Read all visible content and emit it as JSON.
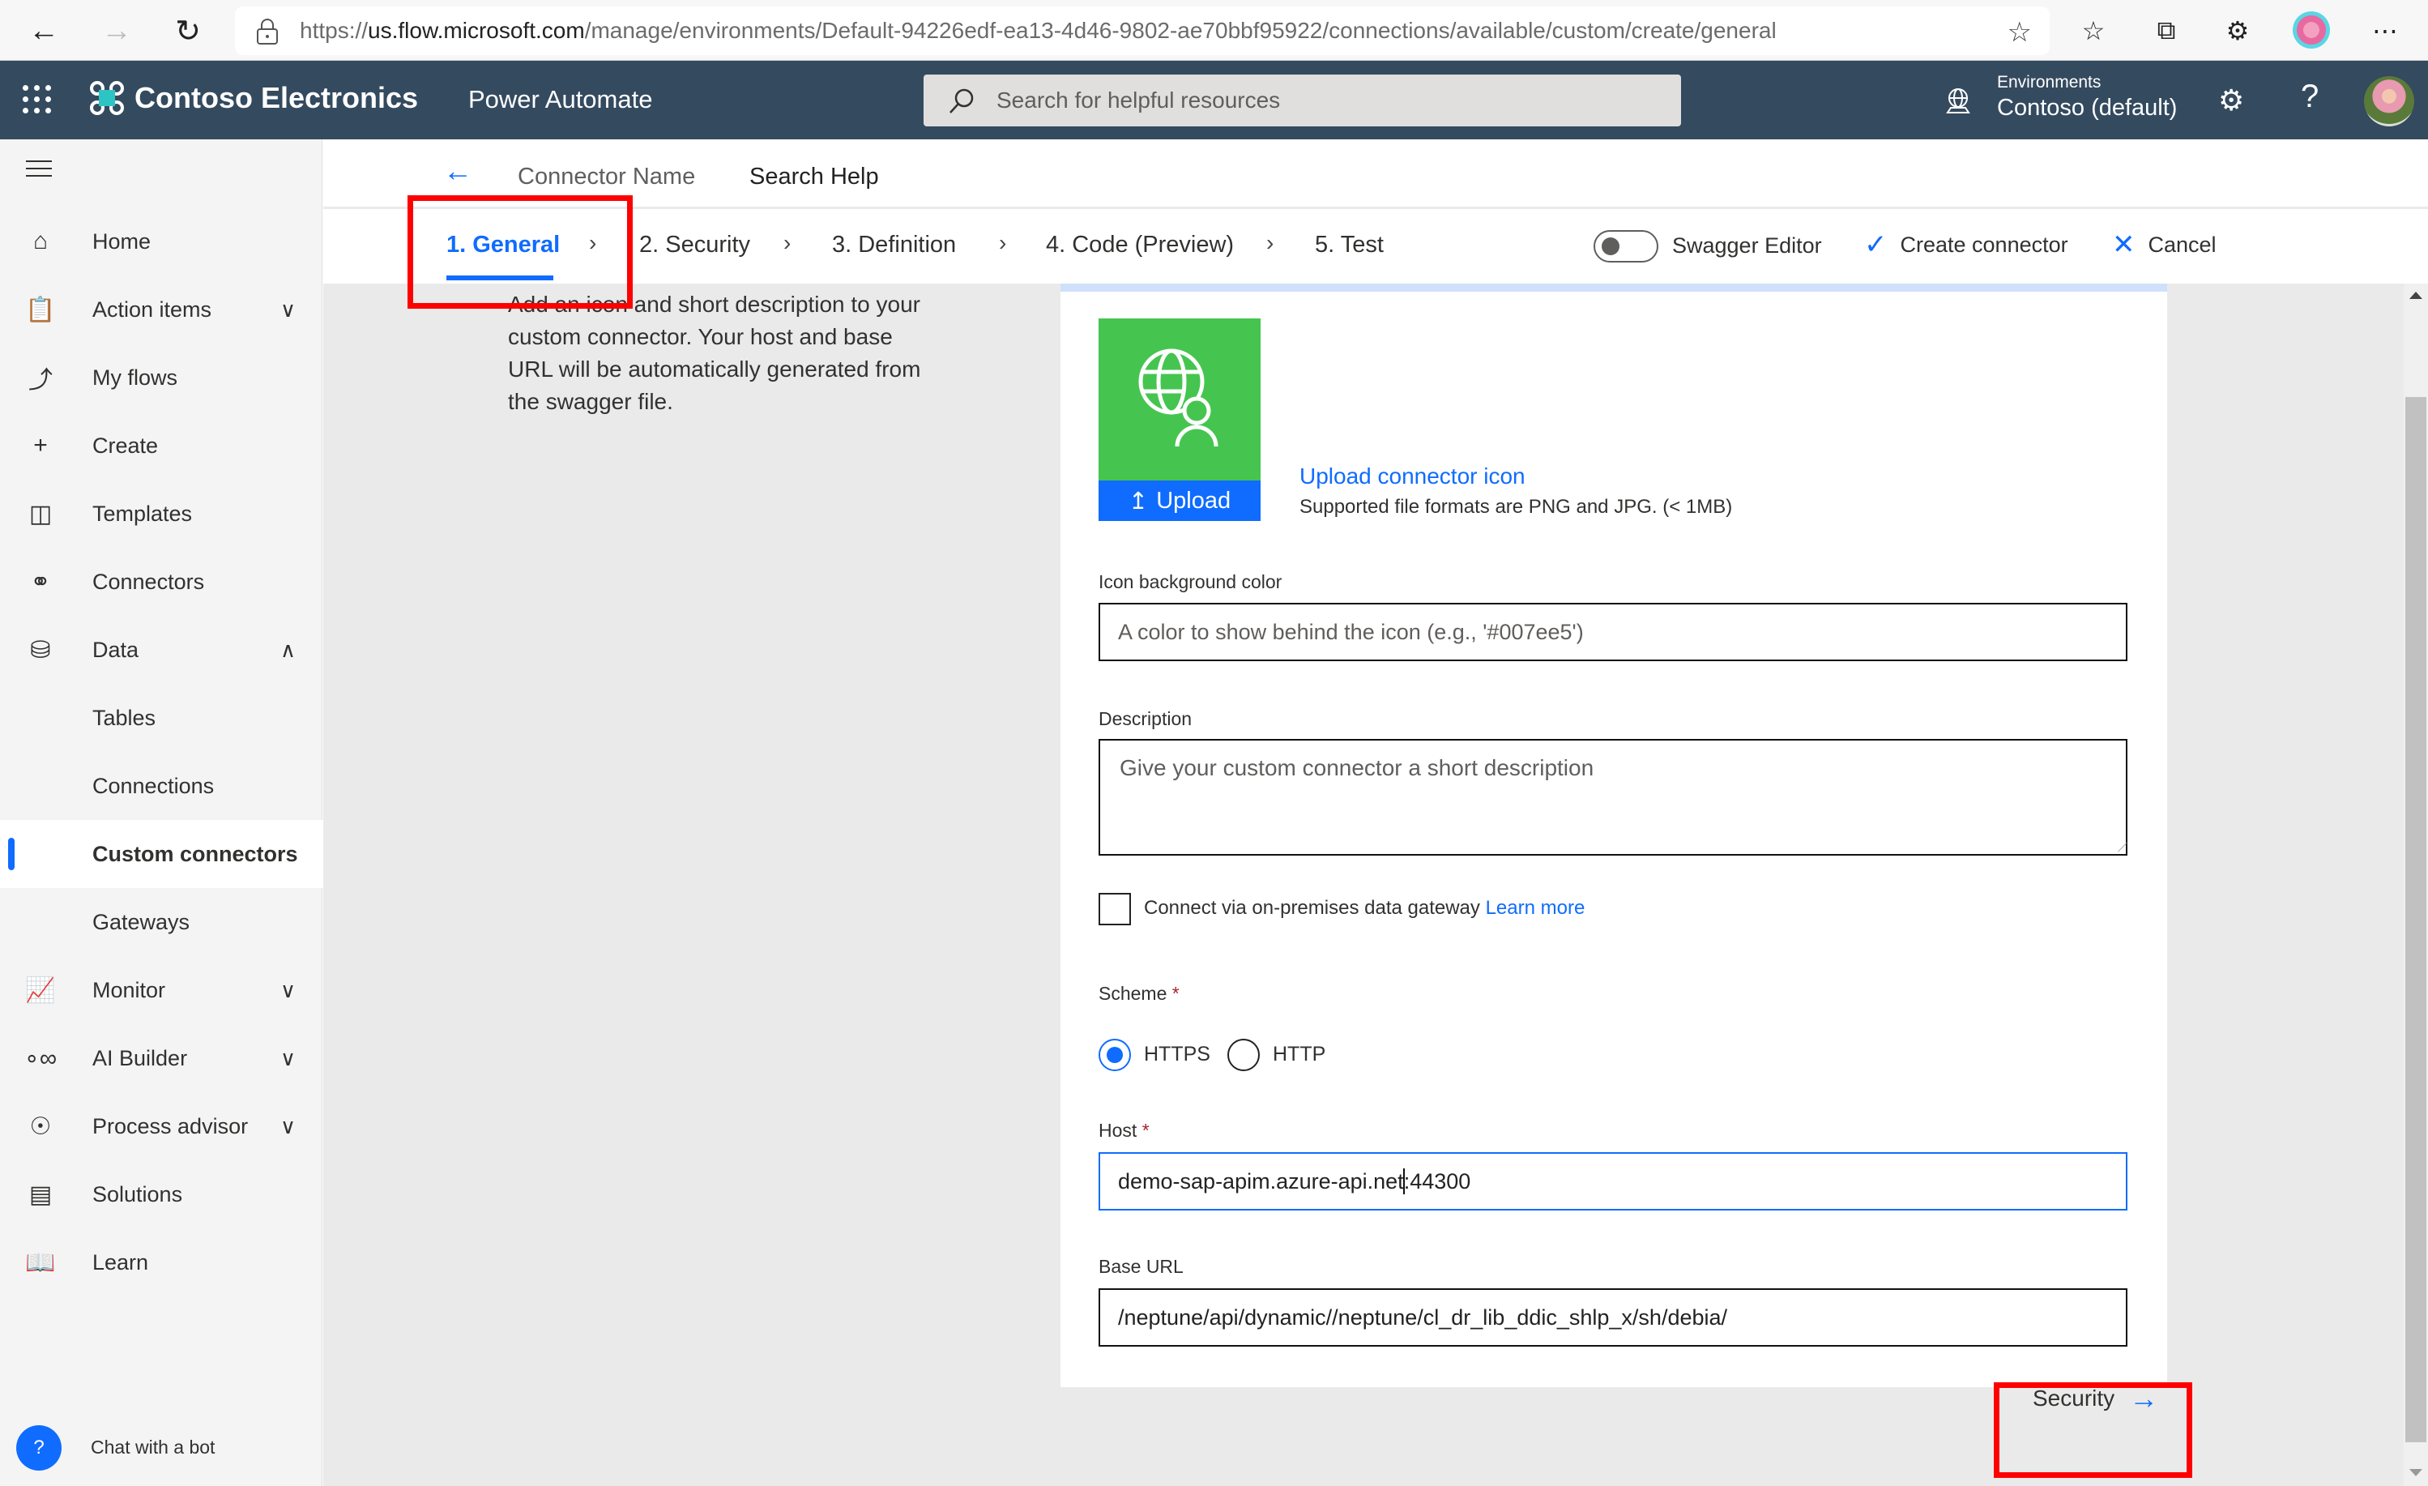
{
  "browser": {
    "url_scheme": "https://",
    "url_host": "us.flow.microsoft.com",
    "url_path": "/manage/environments/Default-94226edf-ea13-4d46-9802-ae70bbf95922/connections/available/custom/create/general"
  },
  "header": {
    "brand": "Contoso Electronics",
    "product": "Power Automate",
    "search_placeholder": "Search for helpful resources",
    "env_label": "Environments",
    "env_value": "Contoso (default)"
  },
  "sidebar": {
    "items": [
      {
        "label": "Home",
        "icon": "home-icon"
      },
      {
        "label": "Action items",
        "icon": "clipboard-icon",
        "chevron": "down"
      },
      {
        "label": "My flows",
        "icon": "flow-icon"
      },
      {
        "label": "Create",
        "icon": "plus-icon"
      },
      {
        "label": "Templates",
        "icon": "templates-icon"
      },
      {
        "label": "Connectors",
        "icon": "plug-icon"
      },
      {
        "label": "Data",
        "icon": "database-icon",
        "chevron": "up"
      },
      {
        "label": "Tables"
      },
      {
        "label": "Connections"
      },
      {
        "label": "Custom connectors",
        "active": true
      },
      {
        "label": "Gateways"
      },
      {
        "label": "Monitor",
        "icon": "monitor-icon",
        "chevron": "down"
      },
      {
        "label": "AI Builder",
        "icon": "ai-builder-icon",
        "chevron": "down"
      },
      {
        "label": "Process advisor",
        "icon": "process-advisor-icon",
        "chevron": "down"
      },
      {
        "label": "Solutions",
        "icon": "solutions-icon"
      },
      {
        "label": "Learn",
        "icon": "book-icon"
      }
    ],
    "chatbot_label": "Chat with a bot"
  },
  "breadcrumb": {
    "connector_name": "Connector Name",
    "search_help": "Search Help"
  },
  "steps": [
    {
      "label": "1. General",
      "active": true
    },
    {
      "label": "2. Security"
    },
    {
      "label": "3. Definition"
    },
    {
      "label": "4. Code (Preview)"
    },
    {
      "label": "5. Test"
    }
  ],
  "toolbar": {
    "swagger_editor": "Swagger Editor",
    "swagger_on": false,
    "create_connector": "Create connector",
    "cancel": "Cancel"
  },
  "general": {
    "intro": "Add an icon and short description to your custom connector. Your host and base URL will be automatically generated from the swagger file.",
    "upload_button": "Upload",
    "upload_link": "Upload connector icon",
    "upload_hint": "Supported file formats are PNG and JPG. (< 1MB)",
    "icon_tile_color": "#45c550",
    "icon_bg_label": "Icon background color",
    "icon_bg_placeholder": "A color to show behind the icon (e.g., '#007ee5')",
    "description_label": "Description",
    "description_placeholder": "Give your custom connector a short description",
    "gateway_label": "Connect via on-premises data gateway",
    "gateway_checked": false,
    "learn_more": "Learn more",
    "scheme_label": "Scheme",
    "scheme_options": [
      "HTTPS",
      "HTTP"
    ],
    "scheme_selected": "HTTPS",
    "host_label": "Host",
    "host_value_before_caret": "demo-sap-apim.azure-api.net",
    "host_value_after_caret": ":44300",
    "base_url_label": "Base URL",
    "base_url_value": "/neptune/api/dynamic//neptune/cl_dr_lib_ddic_shlp_x/sh/debia/",
    "required_marker": "*"
  },
  "footer": {
    "next_label": "Security"
  },
  "colors": {
    "accent": "#0f6cff",
    "header_bg": "#344a5f",
    "annotation": "#ff0000"
  }
}
